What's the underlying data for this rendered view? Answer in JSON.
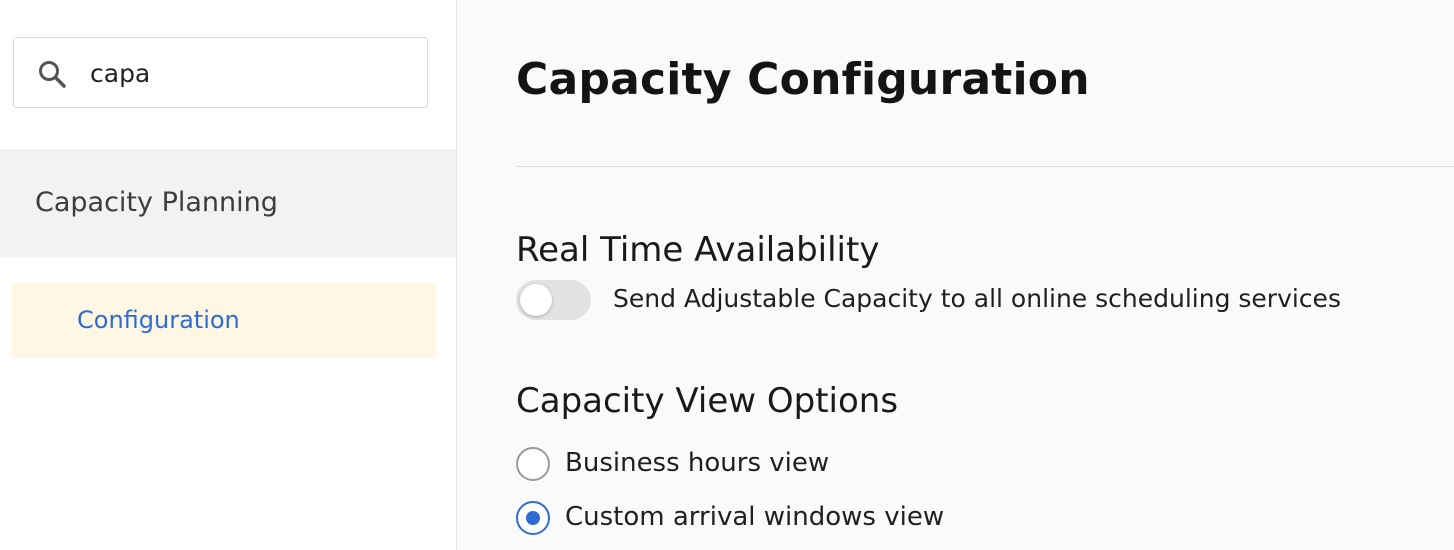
{
  "sidebar": {
    "search": {
      "value": "capa",
      "placeholder": "",
      "icon": "search-icon"
    },
    "group": {
      "label": "Capacity Planning"
    },
    "items": [
      {
        "label": "Configuration",
        "selected": true
      }
    ]
  },
  "main": {
    "title": "Capacity Configuration",
    "real_time": {
      "heading": "Real Time Availability",
      "toggle_label": "Send Adjustable Capacity to all online scheduling services",
      "toggle_on": false
    },
    "view_options": {
      "heading": "Capacity View Options",
      "options": [
        {
          "label": "Business hours view",
          "checked": false
        },
        {
          "label": "Custom arrival windows view",
          "checked": true
        }
      ]
    }
  },
  "colors": {
    "accent": "#2f6bd4",
    "selected_item_bg": "#fdf7e3",
    "group_bg": "#f2f2f2"
  }
}
